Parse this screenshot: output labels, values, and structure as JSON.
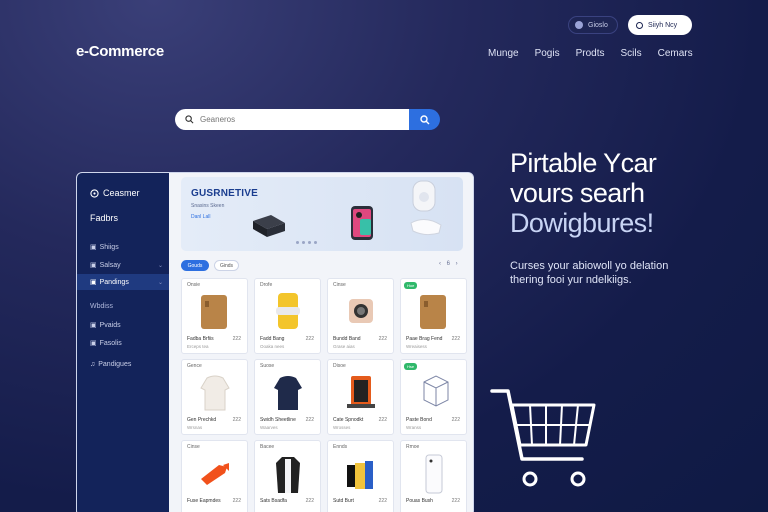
{
  "header": {
    "logo": "e-Commerce",
    "nav": [
      "Munge",
      "Pogis",
      "Prodts",
      "Scils",
      "Cemars"
    ],
    "pill_dark_label": "Gioslo",
    "pill_light_label": "Siiyh Ncy"
  },
  "search": {
    "placeholder": "Geaneros"
  },
  "sidebar": {
    "title": "Ceasmer",
    "subtitle": "Fadbrs",
    "items": [
      {
        "label": "Shiigs"
      },
      {
        "label": "Salsay"
      },
      {
        "label": "Pandings"
      }
    ],
    "section_head": "Wbdiss",
    "items2": [
      {
        "label": "Pvaids"
      },
      {
        "label": "Fasolis"
      },
      {
        "label": "Pandigues"
      }
    ]
  },
  "banner": {
    "title": "GUSRNETIVE",
    "subtitle": "Snasins Skeen",
    "link": "Danl Lall"
  },
  "filters": {
    "chip_active": "Gouds",
    "chip_inactive": "Ginds",
    "pager": "‹ 6 ›"
  },
  "products": [
    {
      "brand": "Onsie",
      "badge": "",
      "name": "Fadba Brfiis",
      "price": "222",
      "meta": "Erceps tea"
    },
    {
      "brand": "Drofe",
      "badge": "",
      "name": "Fadd Bang",
      "price": "222",
      "meta": "Ooaka nees"
    },
    {
      "brand": "Cinse",
      "badge": "",
      "name": "Bundd Band",
      "price": "222",
      "meta": "Grase aias"
    },
    {
      "brand": "",
      "badge": "Hoe",
      "name": "Paae Brag Fend",
      "price": "222",
      "meta": "Wreaisess"
    },
    {
      "brand": "Gence",
      "badge": "",
      "name": "Gen Prechkd",
      "price": "222",
      "meta": "Wrsnas"
    },
    {
      "brand": "Suose",
      "badge": "",
      "name": "Swidh Sheetline",
      "price": "222",
      "meta": "Waarves"
    },
    {
      "brand": "Disoe",
      "badge": "",
      "name": "Cate Spnodkt",
      "price": "222",
      "meta": "Wrosses"
    },
    {
      "brand": "",
      "badge": "Hse",
      "name": "Paste Bond",
      "price": "222",
      "meta": "Wranss"
    },
    {
      "brand": "Cinse",
      "badge": "",
      "name": "Fuse Eapmdes",
      "price": "222",
      "meta": ""
    },
    {
      "brand": "Bacee",
      "badge": "",
      "name": "Sats Bsadfa",
      "price": "222",
      "meta": ""
    },
    {
      "brand": "Ennds",
      "badge": "",
      "name": "Sutd Burt",
      "price": "222",
      "meta": ""
    },
    {
      "brand": "Rmoe",
      "badge": "",
      "name": "Pouas Bush",
      "price": "222",
      "meta": ""
    }
  ],
  "hero": {
    "line1": "Pirtable Ycar",
    "line2": "vours searh",
    "line3": "Dowigbures!",
    "subtitle": "Curses your abiowoll yo delation thering fooi yur ndelkiigs."
  },
  "colors": {
    "accent": "#2d6fe0",
    "sidebar": "#13235a",
    "badge_green": "#2fb86a"
  }
}
